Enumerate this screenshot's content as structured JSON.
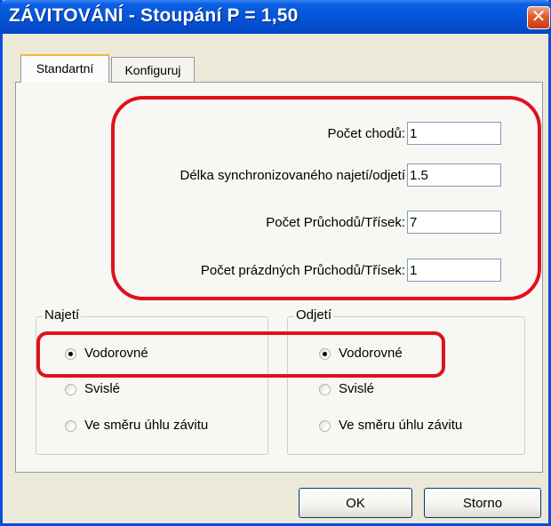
{
  "window": {
    "title": "ZÁVITOVÁNÍ - Stoupání P = 1,50",
    "close_label": "✕"
  },
  "tabs": [
    {
      "label": "Standartní",
      "active": true
    },
    {
      "label": "Konfiguruj",
      "active": false
    }
  ],
  "fields": [
    {
      "label": "Počet chodů:",
      "value": "1"
    },
    {
      "label": "Délka synchronizovaného najetí/odjetí",
      "value": "1.5"
    },
    {
      "label": "Počet Průchodů/Třísek:",
      "value": "7"
    },
    {
      "label": "Počet prázdných Průchodů/Třísek:",
      "value": "1"
    }
  ],
  "groups": {
    "najeti": {
      "title": "Najetí",
      "options": [
        "Vodorovné",
        "Svislé",
        "Ve směru úhlu závitu"
      ],
      "selected": "Vodorovné"
    },
    "odjeti": {
      "title": "Odjetí",
      "options": [
        "Vodorovné",
        "Svislé",
        "Ve směru úhlu závitu"
      ],
      "selected": "Vodorovné"
    }
  },
  "buttons": {
    "ok": "OK",
    "cancel": "Storno"
  },
  "colors": {
    "highlight": "#e0111b",
    "titlebar": "#0553d6",
    "dialog_bg": "#ece9d8"
  }
}
